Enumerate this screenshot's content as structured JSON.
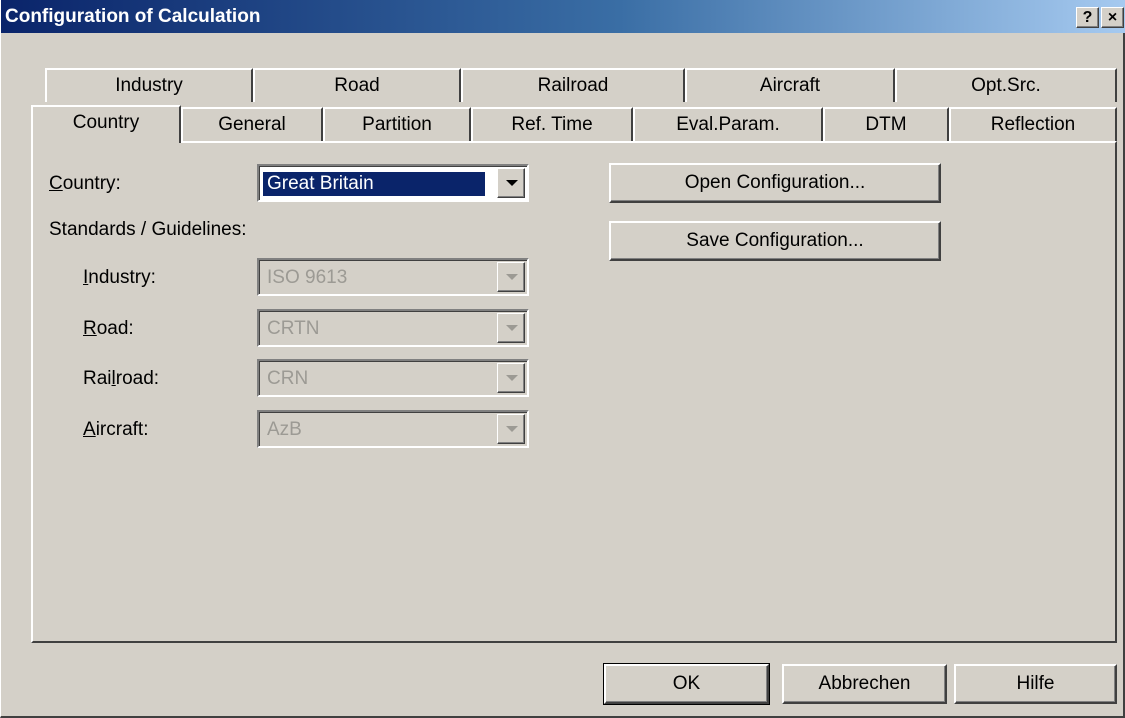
{
  "window": {
    "title": "Configuration of Calculation",
    "help_button": "?",
    "close_button": "×"
  },
  "tabs_back": [
    {
      "label": "Industry"
    },
    {
      "label": "Road"
    },
    {
      "label": "Railroad"
    },
    {
      "label": "Aircraft"
    },
    {
      "label": "Opt.Src."
    }
  ],
  "tabs_front": [
    {
      "label": "Country",
      "active": true
    },
    {
      "label": "General"
    },
    {
      "label": "Partition"
    },
    {
      "label": "Ref. Time"
    },
    {
      "label": "Eval.Param."
    },
    {
      "label": "DTM"
    },
    {
      "label": "Reflection"
    }
  ],
  "country": {
    "label_ul": "C",
    "label_rest": "ountry:",
    "value": "Great Britain"
  },
  "standards": {
    "heading": "Standards / Guidelines:",
    "industry": {
      "label_ul": "I",
      "label_rest": "ndustry:",
      "value": "ISO 9613"
    },
    "road": {
      "label_ul": "R",
      "label_rest": "oad:",
      "value": "CRTN"
    },
    "railroad": {
      "label_pre": "Rai",
      "label_ul": "l",
      "label_rest": "road:",
      "value": "CRN"
    },
    "aircraft": {
      "label_ul": "A",
      "label_rest": "ircraft:",
      "value": "AzB"
    }
  },
  "buttons": {
    "open_config": "Open Configuration...",
    "save_config": "Save Configuration...",
    "ok": "OK",
    "cancel": "Abbrechen",
    "help": "Hilfe"
  },
  "colors": {
    "title_bar": "#0a246a",
    "face": "#d4d0c8",
    "selection": "#0a246a"
  }
}
